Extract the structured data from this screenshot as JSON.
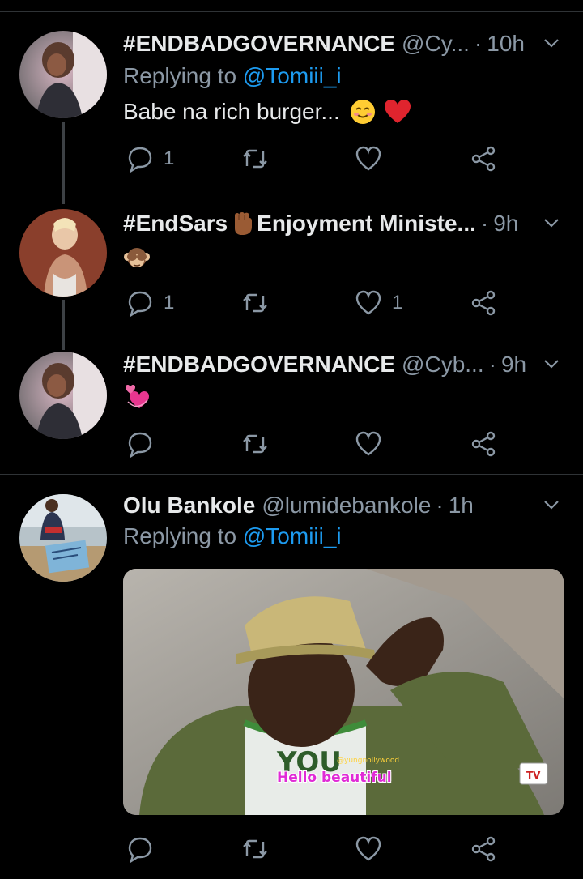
{
  "tweets": [
    {
      "name": "#ENDBADGOVERNANCE",
      "handle": "@Cy...",
      "time": "10h",
      "replying_label": "Replying to",
      "replying_to": "@Tomiii_i",
      "text": "Babe na rich burger...",
      "emoji": [
        "smiling-face",
        "red-heart"
      ],
      "reply_count": "1",
      "like_count": ""
    },
    {
      "name": "#EndSars",
      "name_emoji": "raised-fist",
      "name_suffix": "Enjoyment Ministe...",
      "time": "9h",
      "emoji": [
        "see-no-evil-monkey"
      ],
      "reply_count": "1",
      "like_count": "1"
    },
    {
      "name": "#ENDBADGOVERNANCE",
      "handle": "@Cyb...",
      "time": "9h",
      "emoji": [
        "revolving-hearts"
      ],
      "reply_count": "",
      "like_count": ""
    },
    {
      "name": "Olu Bankole",
      "handle": "@lumidebankole",
      "time": "1h",
      "replying_label": "Replying to",
      "replying_to": "@Tomiii_i",
      "media_caption": "Hello beautiful",
      "media_watermark": "@yungnollywood",
      "reply_count": "",
      "like_count": ""
    }
  ],
  "separator_dot": "·",
  "icons": [
    "reply-icon",
    "retweet-icon",
    "like-icon",
    "share-icon",
    "caret-down-icon"
  ],
  "colors": {
    "background": "#000000",
    "secondary_text": "#8b98a5",
    "link": "#1d9bf0",
    "icon": "#8b98a5"
  }
}
